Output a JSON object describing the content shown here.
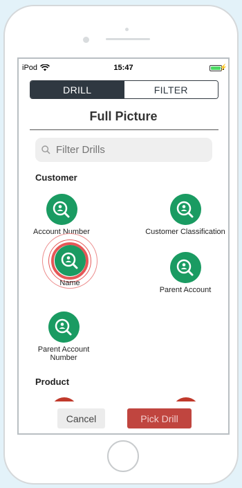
{
  "status_bar": {
    "carrier": "iPod",
    "time": "15:47"
  },
  "segmented_control": {
    "drill_label": "DRILL",
    "filter_label": "FILTER",
    "selected": "DRILL"
  },
  "page_title": "Full Picture",
  "search": {
    "placeholder": "Filter Drills"
  },
  "sections": {
    "customer": {
      "title": "Customer",
      "items": [
        {
          "label": "Account Number"
        },
        {
          "label": "Customer Classification"
        },
        {
          "label": "Name"
        },
        {
          "label": "Parent Account"
        },
        {
          "label": "Parent Account Number"
        }
      ]
    },
    "product": {
      "title": "Product"
    }
  },
  "buttons": {
    "cancel": "Cancel",
    "pick": "Pick Drill"
  },
  "colors": {
    "drill_green": "#1a9b62",
    "pick_red": "#c0453f",
    "segment_dark": "#2f3841",
    "highlight_ring": "#e55757"
  },
  "icons": {
    "drill": "search-user-icon",
    "wifi": "wifi-icon",
    "battery": "battery-icon"
  }
}
